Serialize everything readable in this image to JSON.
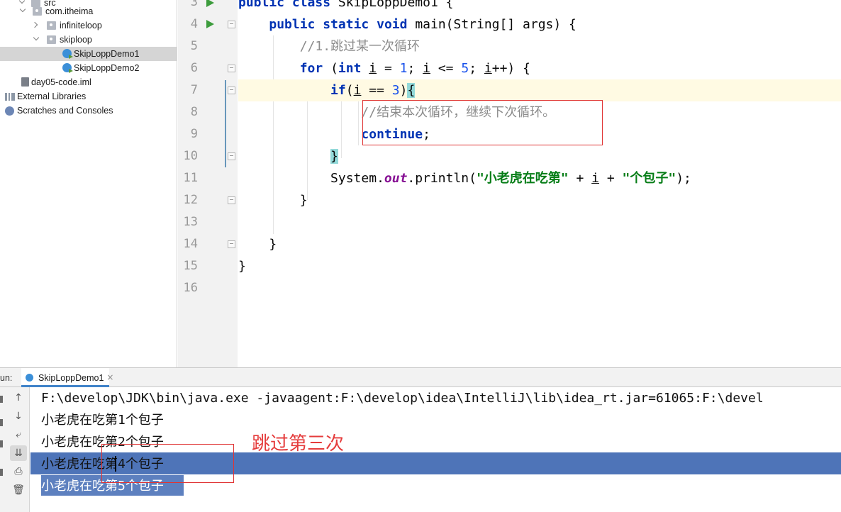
{
  "project_tree": {
    "items": [
      {
        "label": "src",
        "icon": "folder-icon",
        "indent": 1,
        "expanded": true
      },
      {
        "label": "com.itheima",
        "icon": "package-icon",
        "indent": 2,
        "expanded": true
      },
      {
        "label": "infiniteloop",
        "icon": "package-icon",
        "indent": 3,
        "expanded": false
      },
      {
        "label": "skiploop",
        "icon": "package-icon",
        "indent": 3,
        "expanded": true
      },
      {
        "label": "SkipLoppDemo1",
        "icon": "java-class-icon",
        "indent": 4,
        "selected": true
      },
      {
        "label": "SkipLoppDemo2",
        "icon": "java-class-icon",
        "indent": 4
      },
      {
        "label": "day05-code.iml",
        "icon": "iml-file-icon",
        "indent": 1
      },
      {
        "label": "External Libraries",
        "icon": "library-icon",
        "indent": 0
      },
      {
        "label": "Scratches and Consoles",
        "icon": "scratches-icon",
        "indent": 0
      }
    ]
  },
  "editor": {
    "line_numbers": [
      "3",
      "4",
      "5",
      "6",
      "7",
      "8",
      "9",
      "10",
      "11",
      "12",
      "13",
      "14",
      "15",
      "16"
    ],
    "current_line": "7",
    "code": {
      "l3": {
        "kw1": "public",
        "kw2": "class",
        "name": "SkipLoppDemo1",
        "brace": "{"
      },
      "l4": {
        "kw1": "public",
        "kw2": "static",
        "kw3": "void",
        "sig": "main(String[] args) {"
      },
      "l5": {
        "comment": "//1.跳过某一次循环"
      },
      "l6": {
        "kw_for": "for",
        "p1": "(",
        "kw_int": "int",
        "v1": "i",
        "p2": " = ",
        "n1": "1",
        "p3": "; ",
        "v2": "i",
        "p4": " <= ",
        "n2": "5",
        "p5": "; ",
        "v3": "i",
        "p6": "++) {"
      },
      "l7": {
        "kw_if": "if",
        "p1": "(",
        "v": "i",
        "p2": " == ",
        "n": "3",
        "p3": ")",
        "brace": "{"
      },
      "l8": {
        "comment": "//结束本次循环，继续下次循环。"
      },
      "l9": {
        "kw": "continue",
        "semi": ";"
      },
      "l10": {
        "brace": "}"
      },
      "l11": {
        "sys": "System.",
        "out": "out",
        "call": ".println(",
        "s1": "\"小老虎在吃第\"",
        "plus1": " + ",
        "v": "i",
        "plus2": " + ",
        "s2": "\"个包子\"",
        "end": ");"
      },
      "l12": {
        "brace": "}"
      },
      "l14": {
        "brace": "}"
      },
      "l15": {
        "brace": "}"
      }
    }
  },
  "run_window": {
    "label": "un:",
    "tab_label": "SkipLoppDemo1",
    "tab_close": "×",
    "console": [
      "F:\\develop\\JDK\\bin\\java.exe -javaagent:F:\\develop\\idea\\IntelliJ\\lib\\idea_rt.jar=61065:F:\\devel",
      "小老虎在吃第1个包子",
      "小老虎在吃第2个包子",
      "小老虎在吃第4个包子",
      "小老虎在吃第5个包子"
    ]
  },
  "annotation": "跳过第三次",
  "colors": {
    "keyword": "#0033b3",
    "string": "#067d17",
    "comment": "#8c8c8c",
    "number": "#1750eb",
    "selection": "#4e74b8",
    "annotation_red": "#e03434"
  }
}
